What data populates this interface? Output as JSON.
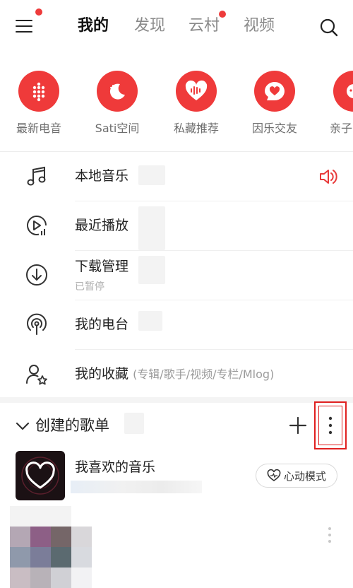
{
  "header": {
    "tabs": [
      {
        "label": "我的",
        "active": true
      },
      {
        "label": "发现",
        "active": false
      },
      {
        "label": "云村",
        "active": false,
        "badge": true
      },
      {
        "label": "视频",
        "active": false
      }
    ],
    "icons": [
      "menu-icon",
      "search-icon"
    ]
  },
  "quick_actions": [
    {
      "label": "最新电音",
      "icon": "dots-grid-icon"
    },
    {
      "label": "Sati空间",
      "icon": "moon-icon"
    },
    {
      "label": "私藏推荐",
      "icon": "heart-wave-icon"
    },
    {
      "label": "因乐交友",
      "icon": "heart-chat-icon"
    },
    {
      "label": "亲子",
      "icon": "child-icon"
    }
  ],
  "library": [
    {
      "title": "本地音乐",
      "icon": "music-note-icon",
      "extra_icon": "speaker-icon"
    },
    {
      "title": "最近播放",
      "icon": "recent-play-icon"
    },
    {
      "title": "下载管理",
      "subtitle": "已暂停",
      "icon": "download-icon"
    },
    {
      "title": "我的电台",
      "icon": "podcast-icon"
    },
    {
      "title": "我的收藏",
      "hint": "(专辑/歌手/视频/专栏/Mlog)",
      "icon": "star-user-icon"
    }
  ],
  "playlists": {
    "section_title": "创建的歌单",
    "items": [
      {
        "title": "我喜欢的音乐",
        "button": "心动模式"
      }
    ]
  },
  "colors": {
    "accent": "#ef3a3a",
    "text": "#222222",
    "muted": "#9a9a9a"
  }
}
